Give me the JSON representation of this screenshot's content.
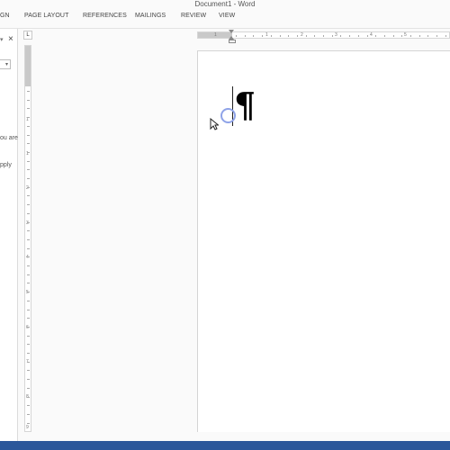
{
  "window": {
    "title": "Document1 - Word"
  },
  "ribbon": {
    "tabs": [
      {
        "label": "GN"
      },
      {
        "label": "PAGE LAYOUT"
      },
      {
        "label": "REFERENCES"
      },
      {
        "label": "MAILINGS"
      },
      {
        "label": "REVIEW"
      },
      {
        "label": "VIEW"
      }
    ]
  },
  "task_pane": {
    "dropdown_icon": "dropdown-arrow-icon",
    "close_label": "×",
    "text_line_1": "ou are",
    "text_line_2": "pply"
  },
  "ruler": {
    "tab_selector_label": "L",
    "horizontal_numbers": [
      "1",
      "1",
      "2",
      "3",
      "4",
      "5"
    ],
    "vertical_numbers": [
      "1",
      "1",
      "2",
      "3",
      "4",
      "5",
      "6",
      "7",
      "8",
      "9"
    ]
  },
  "document": {
    "paragraph_mark": "¶"
  },
  "colors": {
    "status_bar": "#2b579a",
    "click_highlight": "#8fa3e8"
  }
}
